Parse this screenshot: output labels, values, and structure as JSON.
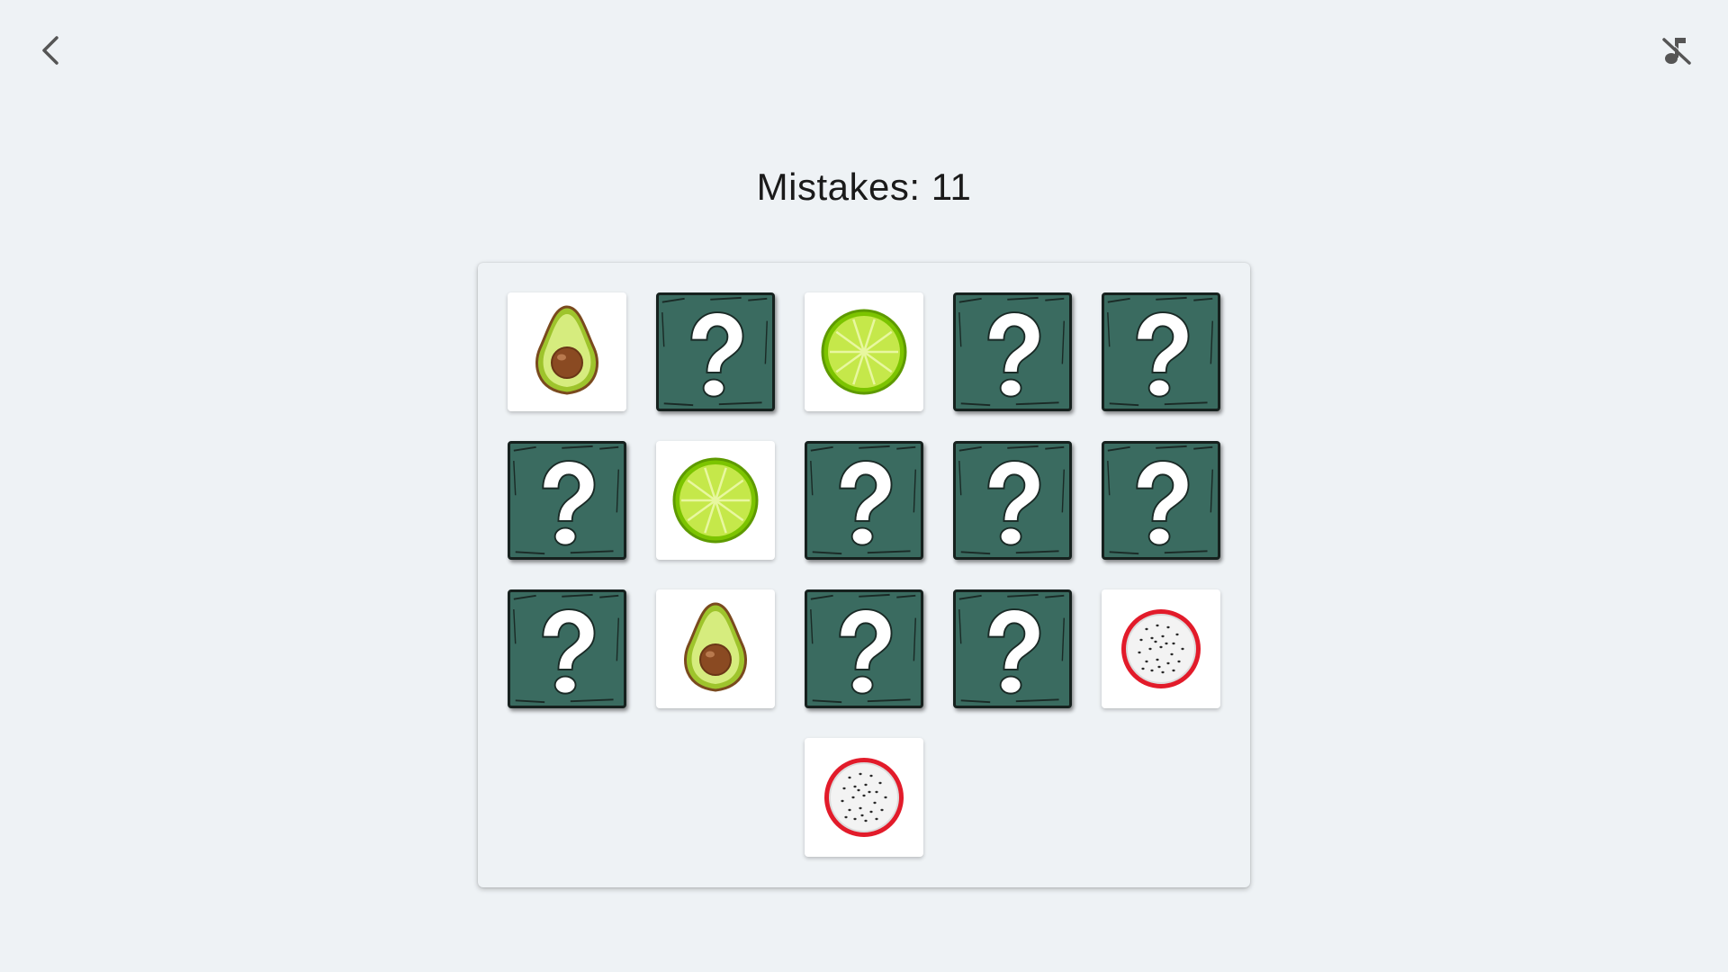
{
  "header": {
    "back_icon": "chevron-left-icon",
    "sound_icon": "music-off-icon",
    "mistakes_label": "Mistakes: 11"
  },
  "colors": {
    "background": "#eef2f5",
    "card_back": "#3a6b60",
    "card_back_border": "#16211e",
    "card_face": "#ffffff"
  },
  "board": {
    "columns": 5,
    "cards": [
      {
        "state": "revealed",
        "fruit": "avocado"
      },
      {
        "state": "hidden",
        "fruit": null
      },
      {
        "state": "revealed",
        "fruit": "lime"
      },
      {
        "state": "hidden",
        "fruit": null
      },
      {
        "state": "hidden",
        "fruit": null
      },
      {
        "state": "hidden",
        "fruit": null
      },
      {
        "state": "revealed",
        "fruit": "lime"
      },
      {
        "state": "hidden",
        "fruit": null
      },
      {
        "state": "hidden",
        "fruit": null
      },
      {
        "state": "hidden",
        "fruit": null
      },
      {
        "state": "hidden",
        "fruit": null
      },
      {
        "state": "revealed",
        "fruit": "avocado"
      },
      {
        "state": "hidden",
        "fruit": null
      },
      {
        "state": "hidden",
        "fruit": null
      },
      {
        "state": "revealed",
        "fruit": "dragon-fruit"
      },
      {
        "state": "revealed",
        "fruit": "dragon-fruit"
      }
    ]
  }
}
